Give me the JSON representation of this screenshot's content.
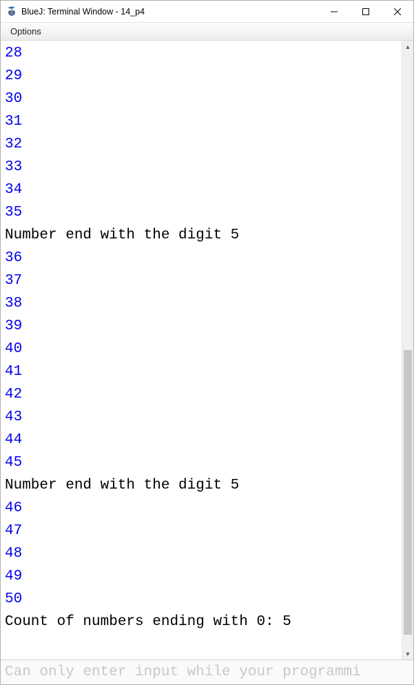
{
  "window": {
    "title": "BlueJ: Terminal Window - 14_p4"
  },
  "menubar": {
    "options_label": "Options"
  },
  "terminal": {
    "lines": [
      {
        "kind": "out",
        "text": "28"
      },
      {
        "kind": "out",
        "text": "29"
      },
      {
        "kind": "out",
        "text": "30"
      },
      {
        "kind": "out",
        "text": "31"
      },
      {
        "kind": "out",
        "text": "32"
      },
      {
        "kind": "out",
        "text": "33"
      },
      {
        "kind": "out",
        "text": "34"
      },
      {
        "kind": "out",
        "text": "35"
      },
      {
        "kind": "msg",
        "text": "Number end with the digit 5"
      },
      {
        "kind": "out",
        "text": "36"
      },
      {
        "kind": "out",
        "text": "37"
      },
      {
        "kind": "out",
        "text": "38"
      },
      {
        "kind": "out",
        "text": "39"
      },
      {
        "kind": "out",
        "text": "40"
      },
      {
        "kind": "out",
        "text": "41"
      },
      {
        "kind": "out",
        "text": "42"
      },
      {
        "kind": "out",
        "text": "43"
      },
      {
        "kind": "out",
        "text": "44"
      },
      {
        "kind": "out",
        "text": "45"
      },
      {
        "kind": "msg",
        "text": "Number end with the digit 5"
      },
      {
        "kind": "out",
        "text": "46"
      },
      {
        "kind": "out",
        "text": "47"
      },
      {
        "kind": "out",
        "text": "48"
      },
      {
        "kind": "out",
        "text": "49"
      },
      {
        "kind": "out",
        "text": "50"
      },
      {
        "kind": "msg",
        "text": "Count of numbers ending with 0: 5"
      }
    ]
  },
  "scrollbar": {
    "thumb_top_pct": 50,
    "thumb_height_pct": 46
  },
  "input": {
    "placeholder": "Can only enter input while your programmi"
  },
  "colors": {
    "program_output": "#0000ee",
    "system_message": "#000000",
    "placeholder": "#c8c8c8"
  }
}
